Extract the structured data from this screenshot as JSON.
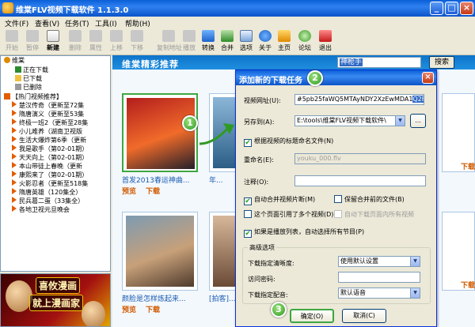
{
  "window": {
    "title": "维棠FLV视频下载软件 1.1.3.0"
  },
  "menu": [
    "文件(F)",
    "查看(V)",
    "任务(T)",
    "工具(I)",
    "帮助(H)"
  ],
  "toolbar": [
    {
      "label": "开始",
      "icon": "start-icon",
      "enabled": false
    },
    {
      "label": "暂停",
      "icon": "pause-icon",
      "enabled": false
    },
    {
      "label": "新建",
      "icon": "new-icon",
      "enabled": true
    },
    {
      "label": "删除",
      "icon": "delete-icon",
      "enabled": false
    },
    {
      "label": "属性",
      "icon": "properties-icon",
      "enabled": false
    },
    {
      "label": "上移",
      "icon": "move-up-icon",
      "enabled": false
    },
    {
      "label": "下移",
      "icon": "move-down-icon",
      "enabled": false
    },
    {
      "label": "复制地址",
      "icon": "copy-url-icon",
      "enabled": false
    },
    {
      "label": "播放",
      "icon": "play-icon",
      "enabled": false
    },
    {
      "label": "转换",
      "icon": "convert-icon",
      "enabled": true
    },
    {
      "label": "合并",
      "icon": "merge-icon",
      "enabled": true
    },
    {
      "label": "选项",
      "icon": "options-icon",
      "enabled": true
    },
    {
      "label": "关于",
      "icon": "about-icon",
      "enabled": true
    },
    {
      "label": "主页",
      "icon": "home-icon",
      "enabled": true
    },
    {
      "label": "论坛",
      "icon": "forum-icon",
      "enabled": true
    },
    {
      "label": "退出",
      "icon": "exit-icon",
      "enabled": true
    }
  ],
  "tree": {
    "root": "维棠",
    "status_items": [
      "正在下载",
      "已下载",
      "已删除"
    ],
    "section": "【热门视频推荐】",
    "videos": [
      "楚汉传奇（更新至72集",
      "隋唐演义（更新至53集",
      "终极一班2（更新至28集",
      "小儿难养（湖南卫视版",
      "生活大爆炸第6季（更新",
      "我是歌手（第02-01期）",
      "天天向上（第02-01期）",
      "本山带徒上春晚（更新",
      "康熙来了（第02-01期）",
      "火影忍者（更新至518集",
      "隋唐英雄（120集全）",
      "民兵葛二蛋（33集全）",
      "各地卫视元旦晚会"
    ]
  },
  "banner": {
    "line1": "喜攸漫画",
    "line2": "就上漫画家"
  },
  "recommend": {
    "title": "维棠精彩推荐",
    "search_text": "神枪手",
    "search_button": "搜索",
    "preview_label": "预览",
    "download_label": "下载",
    "cards": [
      {
        "caption": "首发2013春运神曲..."
      },
      {
        "caption": "年..."
      },
      {
        "caption": "颜脸是怎样炼起来..."
      },
      {
        "caption": "[拍客]..."
      }
    ]
  },
  "dialog": {
    "title": "添加新的下载任务",
    "url_label": "视频网址(U):",
    "url_value": "#5pb25faWQ5MTAyNDY2XzEwMDA1",
    "url_selected": "Q2FmWV9wMg",
    "saveas_label": "另存到(A):",
    "saveas_value": "E:\\tools\\维棠FLV视频下载软件\\",
    "browse_label": "...",
    "use_title_label": "根据视频的标题命名文件(N)",
    "use_title_checked": true,
    "rename_label": "重命名(E):",
    "rename_value": "youku_000.flv",
    "note_label": "注释(O):",
    "note_value": "",
    "auto_merge_label": "自动合并视频片断(M)",
    "auto_merge_checked": true,
    "keep_files_label": "保留合并前的文件(B)",
    "keep_files_checked": false,
    "page_multi_label": "这个页面引用了多个视频(D)",
    "page_multi_checked": false,
    "download_all_page_label": "自动下载页面内所有视频",
    "download_all_page_checked": false,
    "playlist_label": "如果是播放列表，自动选择所有节目(P)",
    "playlist_checked": true,
    "advanced_label": "高级选项",
    "quality_label": "下载指定清晰度:",
    "quality_value": "使用默认设置",
    "password_label": "访问密码:",
    "password_value": "",
    "audio_label": "下载指定配音:",
    "audio_value": "默认语音",
    "ok_label": "确定(O)",
    "cancel_label": "取消(C)"
  },
  "steps": [
    "1",
    "2",
    "3"
  ]
}
